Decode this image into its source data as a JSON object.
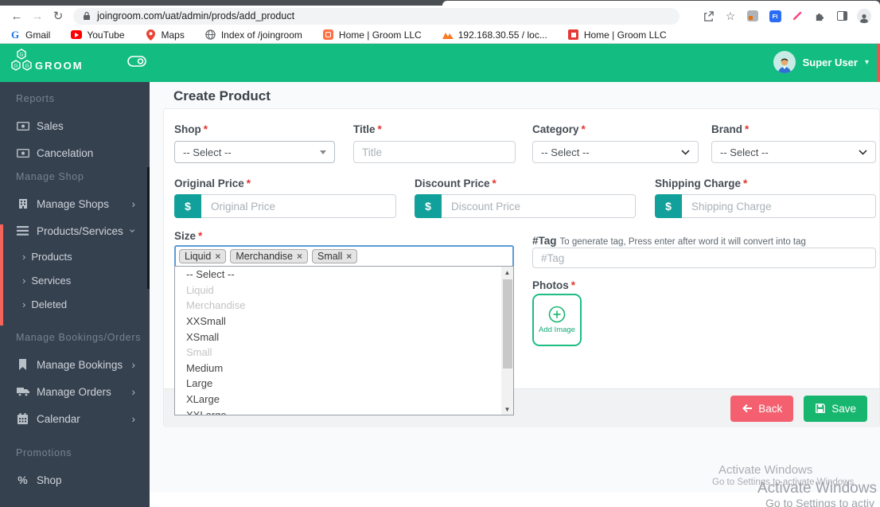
{
  "browser": {
    "url": "joingroom.com/uat/admin/prods/add_product",
    "bookmarks": [
      {
        "label": "Gmail"
      },
      {
        "label": "YouTube"
      },
      {
        "label": "Maps"
      },
      {
        "label": "Index of /joingroom"
      },
      {
        "label": "Home | Groom LLC"
      },
      {
        "label": "192.168.30.55 / loc..."
      },
      {
        "label": "Home | Groom LLC"
      }
    ]
  },
  "header": {
    "brand": "GROOM",
    "user_name": "Super User"
  },
  "sidebar": {
    "sections": [
      {
        "title": "Reports",
        "items": [
          {
            "label": "Sales"
          },
          {
            "label": "Cancelation"
          }
        ]
      },
      {
        "title": "Manage Shop",
        "items": [
          {
            "label": "Manage Shops"
          },
          {
            "label": "Products/Services",
            "children": [
              {
                "label": "Products"
              },
              {
                "label": "Services"
              },
              {
                "label": "Deleted"
              }
            ]
          }
        ]
      },
      {
        "title": "Manage Bookings/Orders",
        "items": [
          {
            "label": "Manage Bookings"
          },
          {
            "label": "Manage Orders"
          },
          {
            "label": "Calendar"
          }
        ]
      },
      {
        "title": "Promotions",
        "items": [
          {
            "label": "Shop"
          }
        ]
      }
    ]
  },
  "main": {
    "title": "Create Product",
    "required_mark": "*",
    "form": {
      "shop": {
        "label": "Shop",
        "value": "-- Select --"
      },
      "product_title": {
        "label": "Title",
        "placeholder": "Title"
      },
      "category": {
        "label": "Category",
        "value": "-- Select --"
      },
      "brand": {
        "label": "Brand",
        "value": "-- Select --"
      },
      "original_price": {
        "label": "Original Price",
        "placeholder": "Original Price",
        "addon": "$"
      },
      "discount_price": {
        "label": "Discount Price",
        "placeholder": "Discount Price",
        "addon": "$"
      },
      "shipping_charge": {
        "label": "Shipping Charge",
        "placeholder": "Shipping Charge",
        "addon": "$"
      },
      "size": {
        "label": "Size",
        "remove_glyph": "×",
        "tags": [
          {
            "label": "Liquid"
          },
          {
            "label": "Merchandise"
          },
          {
            "label": "Small"
          }
        ],
        "options": [
          {
            "label": "-- Select --",
            "disabled": false
          },
          {
            "label": "Liquid",
            "disabled": true
          },
          {
            "label": "Merchandise",
            "disabled": true
          },
          {
            "label": "XXSmall",
            "disabled": false
          },
          {
            "label": "XSmall",
            "disabled": false
          },
          {
            "label": "Small",
            "disabled": true
          },
          {
            "label": "Medium",
            "disabled": false
          },
          {
            "label": "Large",
            "disabled": false
          },
          {
            "label": "XLarge",
            "disabled": false
          },
          {
            "label": "XXLarge",
            "disabled": false
          }
        ]
      },
      "tag": {
        "label": "#Tag",
        "help": "To generate tag, Press enter after word it will convert into tag",
        "placeholder": "#Tag"
      },
      "photos": {
        "label": "Photos",
        "add_image": "Add Image"
      }
    },
    "buttons": {
      "back": "Back",
      "save": "Save"
    }
  },
  "watermark": {
    "small_line1": "Activate Windows",
    "small_line2": "Go to Settings to activate Windows",
    "large_line1": "Activate Windows",
    "large_line2": "Go to Settings to activ"
  },
  "colors": {
    "header_green": "#13bd82",
    "sidebar_bg": "#364150",
    "addon_teal": "#12a19a",
    "back_button_pink": "#f4606f",
    "save_button_green": "#17b66f",
    "active_accent_red": "#f3655c",
    "focus_border_blue": "#5b9bd5"
  }
}
